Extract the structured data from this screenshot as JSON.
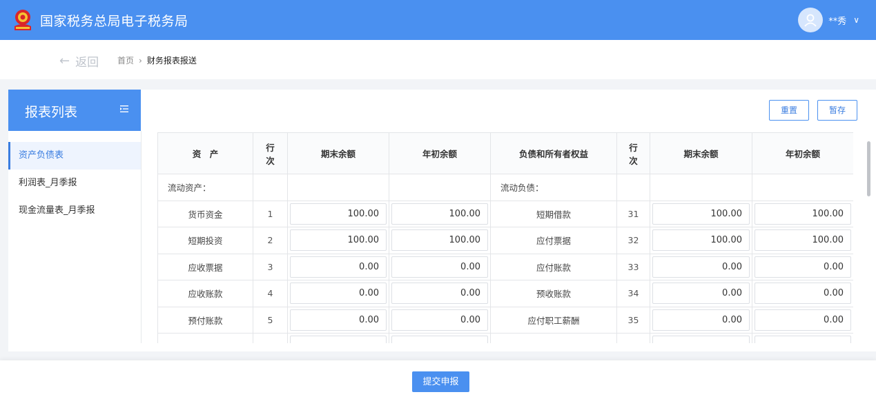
{
  "header": {
    "site_title": "国家税务总局电子税务局",
    "user_name": "**秀",
    "colors": {
      "primary": "#4a90f0",
      "emblem_red": "#d9252a",
      "emblem_gold": "#f5c232"
    }
  },
  "breadcrumb_bar": {
    "back_label": "返回",
    "home": "首页",
    "separator": "›",
    "current": "财务报表报送"
  },
  "sidebar": {
    "title": "报表列表",
    "items": [
      {
        "label": "资产负债表",
        "active": true
      },
      {
        "label": "利润表_月季报",
        "active": false
      },
      {
        "label": "现金流量表_月季报",
        "active": false
      }
    ]
  },
  "toolbar": {
    "reset_label": "重置",
    "save_label": "暂存"
  },
  "table": {
    "headers": [
      "资　产",
      "行\n次",
      "期末余额",
      "年初余额",
      "负债和所有者权益",
      "行\n次",
      "期末余额",
      "年初余额"
    ],
    "section_row": {
      "left": "流动资产：",
      "right": "流动负债："
    },
    "rows": [
      {
        "l_name": "货币资金",
        "l_line": "1",
        "l_end": "100.00",
        "l_begin": "100.00",
        "r_name": "短期借款",
        "r_line": "31",
        "r_end": "100.00",
        "r_begin": "100.00"
      },
      {
        "l_name": "短期投资",
        "l_line": "2",
        "l_end": "100.00",
        "l_begin": "100.00",
        "r_name": "应付票据",
        "r_line": "32",
        "r_end": "100.00",
        "r_begin": "100.00"
      },
      {
        "l_name": "应收票据",
        "l_line": "3",
        "l_end": "0.00",
        "l_begin": "0.00",
        "r_name": "应付账款",
        "r_line": "33",
        "r_end": "0.00",
        "r_begin": "0.00"
      },
      {
        "l_name": "应收账款",
        "l_line": "4",
        "l_end": "0.00",
        "l_begin": "0.00",
        "r_name": "预收账款",
        "r_line": "34",
        "r_end": "0.00",
        "r_begin": "0.00"
      },
      {
        "l_name": "预付账款",
        "l_line": "5",
        "l_end": "0.00",
        "l_begin": "0.00",
        "r_name": "应付职工薪酬",
        "r_line": "35",
        "r_end": "0.00",
        "r_begin": "0.00"
      }
    ]
  },
  "footer": {
    "submit_label": "提交申报"
  }
}
